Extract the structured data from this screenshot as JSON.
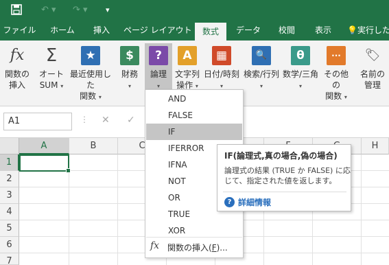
{
  "qat": {
    "save_icon": "save-icon",
    "undo_icon": "undo-icon",
    "redo_icon": "redo-icon",
    "customize_icon": "customize-icon"
  },
  "tabs": [
    "ファイル",
    "ホーム",
    "挿入",
    "ページ レイアウト",
    "数式",
    "データ",
    "校閲",
    "表示",
    "実行した"
  ],
  "active_tab": "数式",
  "ribbon": {
    "buttons": [
      {
        "label": "関数の\n挿入",
        "icon": "fx"
      },
      {
        "label": "オート\nSUM",
        "icon": "Σ"
      },
      {
        "label": "最近使用した\n関数",
        "icon": "★"
      },
      {
        "label": "財務",
        "icon": "$"
      },
      {
        "label": "論理",
        "icon": "?"
      },
      {
        "label": "文字列\n操作",
        "icon": "A"
      },
      {
        "label": "日付/時刻",
        "icon": "▦"
      },
      {
        "label": "検索/行列",
        "icon": "🔍"
      },
      {
        "label": "数学/三角",
        "icon": "θ"
      },
      {
        "label": "その他の\n関数",
        "icon": "···"
      },
      {
        "label": "名前の\n管理",
        "icon": "🏷"
      }
    ]
  },
  "namebox": {
    "value": "A1"
  },
  "formula_bar": {
    "cancel": "✕",
    "enter": "✓"
  },
  "grid": {
    "columns": [
      "A",
      "B",
      "C",
      "D",
      "E",
      "F",
      "G",
      "H"
    ],
    "rows": [
      "1",
      "2",
      "3",
      "4",
      "5",
      "6",
      "7"
    ],
    "selected_cell": "A1"
  },
  "dropdown": {
    "items": [
      "AND",
      "FALSE",
      "IF",
      "IFERROR",
      "IFNA",
      "NOT",
      "OR",
      "TRUE",
      "XOR"
    ],
    "highlighted": "IF",
    "insert_label_prefix": "関数の挿入(",
    "insert_label_key": "F",
    "insert_label_suffix": ")..."
  },
  "tooltip": {
    "title": "IF(論理式,真の場合,偽の場合)",
    "body": "論理式の結果 (TRUE か FALSE) に応じて、指定された値を返します。",
    "help_label": "詳細情報"
  },
  "colors": {
    "accent": "#217346",
    "ribbon_bg": "#f3f3f3",
    "highlight": "#c5c5c5"
  }
}
